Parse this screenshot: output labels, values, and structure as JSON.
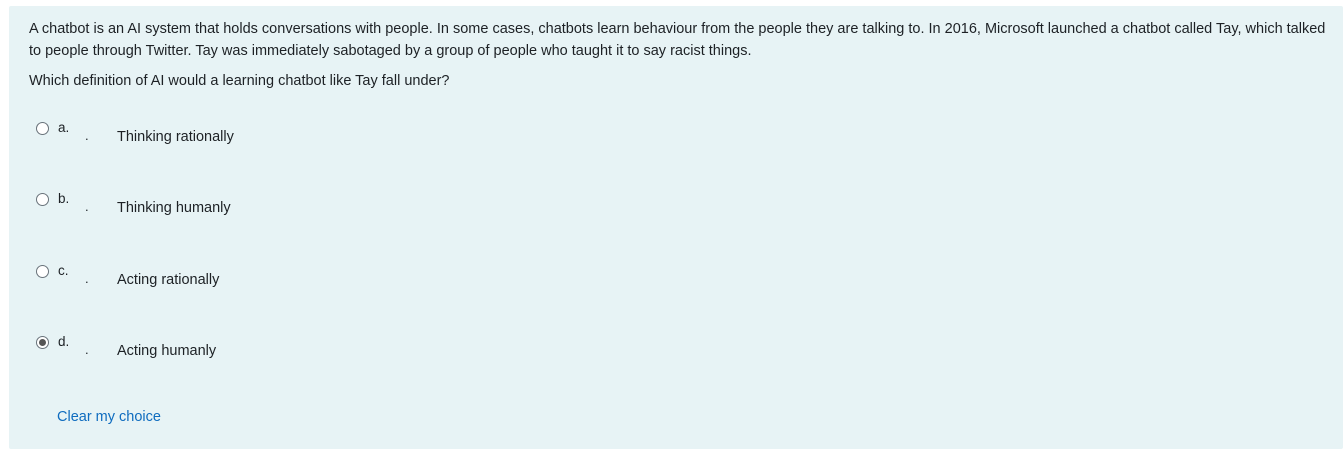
{
  "question": {
    "stem": "A chatbot is an AI system that holds conversations with people. In some cases, chatbots learn behaviour from the people they are talking to. In 2016, Microsoft launched a chatbot called Tay, which talked to people through Twitter. Tay was immediately sabotaged by a group of people who taught it to say racist things.",
    "prompt": "Which definition of AI would a learning chatbot like Tay fall under?"
  },
  "options": [
    {
      "letter": "a.",
      "separator": ".",
      "text": "Thinking rationally",
      "selected": false
    },
    {
      "letter": "b.",
      "separator": ".",
      "text": "Thinking humanly",
      "selected": false
    },
    {
      "letter": "c.",
      "separator": ".",
      "text": "Acting rationally",
      "selected": false
    },
    {
      "letter": "d.",
      "separator": ".",
      "text": "Acting humanly",
      "selected": true
    }
  ],
  "actions": {
    "clear_label": "Clear my choice"
  },
  "colors": {
    "panel_background": "#e7f3f5",
    "link": "#0f6cbf",
    "text": "#1d2125"
  }
}
